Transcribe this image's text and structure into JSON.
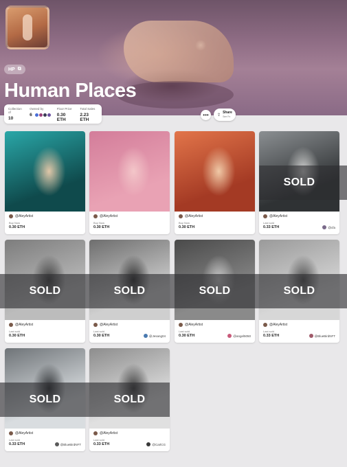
{
  "collection": {
    "badge": "HP",
    "badge_icon": "copy-icon",
    "title": "Human Places"
  },
  "stats": [
    {
      "label": "Collection of",
      "value": "10"
    },
    {
      "label": "Owned by",
      "value": "6"
    },
    {
      "label": "Floor Price",
      "value": "0.30 ETH"
    },
    {
      "label": "Total Sales",
      "value": "2.23 ETH"
    }
  ],
  "owner_dot_colors": [
    "#4a6fd8",
    "#9a3f7a",
    "#3a3a55",
    "#6a4fa0"
  ],
  "actions": {
    "more_icon": "ellipsis-icon",
    "share_label": "Share",
    "share_sub": "See Fn",
    "share_icon": "upload-icon"
  },
  "overlay_text": "SOLD",
  "cards": [
    {
      "creator": "@AleyArtist",
      "status_label": "Buy Now",
      "price": "0.30 ETH",
      "owner": "",
      "sold": false,
      "palette": [
        "#0f4a4c",
        "#2aa7a8",
        "#e1c7a8"
      ]
    },
    {
      "creator": "@AleyArtist",
      "status_label": "Buy Now",
      "price": "0.30 ETH",
      "owner": "",
      "sold": false,
      "palette": [
        "#e9a2b4",
        "#d37d9a",
        "#f3c6c9"
      ]
    },
    {
      "creator": "@AleyArtist",
      "status_label": "Buy Now",
      "price": "0.30 ETH",
      "owner": "",
      "sold": false,
      "palette": [
        "#a43a24",
        "#e2754a",
        "#f0c9a7"
      ]
    },
    {
      "creator": "@AleyArtist",
      "status_label": "Last sold",
      "price": "0.33 ETH",
      "owner": "@cfa",
      "sold": true,
      "palette": [
        "#2f3234",
        "#8b8f92",
        "#d6d7d6"
      ]
    },
    {
      "creator": "@AleyArtist",
      "status_label": "Last sold",
      "price": "0.30 ETH",
      "owner": "",
      "sold": true,
      "palette": [
        "#bcbcbc",
        "#7d7d7d",
        "#3e3e3e"
      ]
    },
    {
      "creator": "@AleyArtist",
      "status_label": "Last sold",
      "price": "0.30 ETH",
      "owner": "@Jesang04",
      "sold": true,
      "palette": [
        "#cfcfcf",
        "#6e6e6e",
        "#2c2c2c"
      ]
    },
    {
      "creator": "@AleyArtist",
      "status_label": "Last sold",
      "price": "0.30 ETH",
      "owner": "@angel5050",
      "sold": true,
      "palette": [
        "#8a8a8a",
        "#4a4a4a",
        "#c9c9c9"
      ]
    },
    {
      "creator": "@AleyArtist",
      "status_label": "Last sold",
      "price": "0.33 ETH",
      "owner": "@BlueBirdNFT",
      "sold": true,
      "palette": [
        "#d7d7d7",
        "#9a9a9a",
        "#4f4f4f"
      ]
    },
    {
      "creator": "@AleyArtist",
      "status_label": "Last sold",
      "price": "0.33 ETH",
      "owner": "@BlueBirdNFT",
      "sold": true,
      "palette": [
        "#d9dde0",
        "#6f7478",
        "#2a2d30"
      ]
    },
    {
      "creator": "@AleyArtist",
      "status_label": "Last sold",
      "price": "0.33 ETH",
      "owner": "@CarlCG",
      "sold": true,
      "palette": [
        "#e0e0e0",
        "#8d8d8d",
        "#3a3a3a"
      ]
    }
  ],
  "owner_avatar_colors": [
    "#7a6a8a",
    "#4a7ab0",
    "#c85a7a",
    "#a05a6a",
    "#5a5a5a",
    "#3a3a3a",
    "#5a5a5a"
  ]
}
